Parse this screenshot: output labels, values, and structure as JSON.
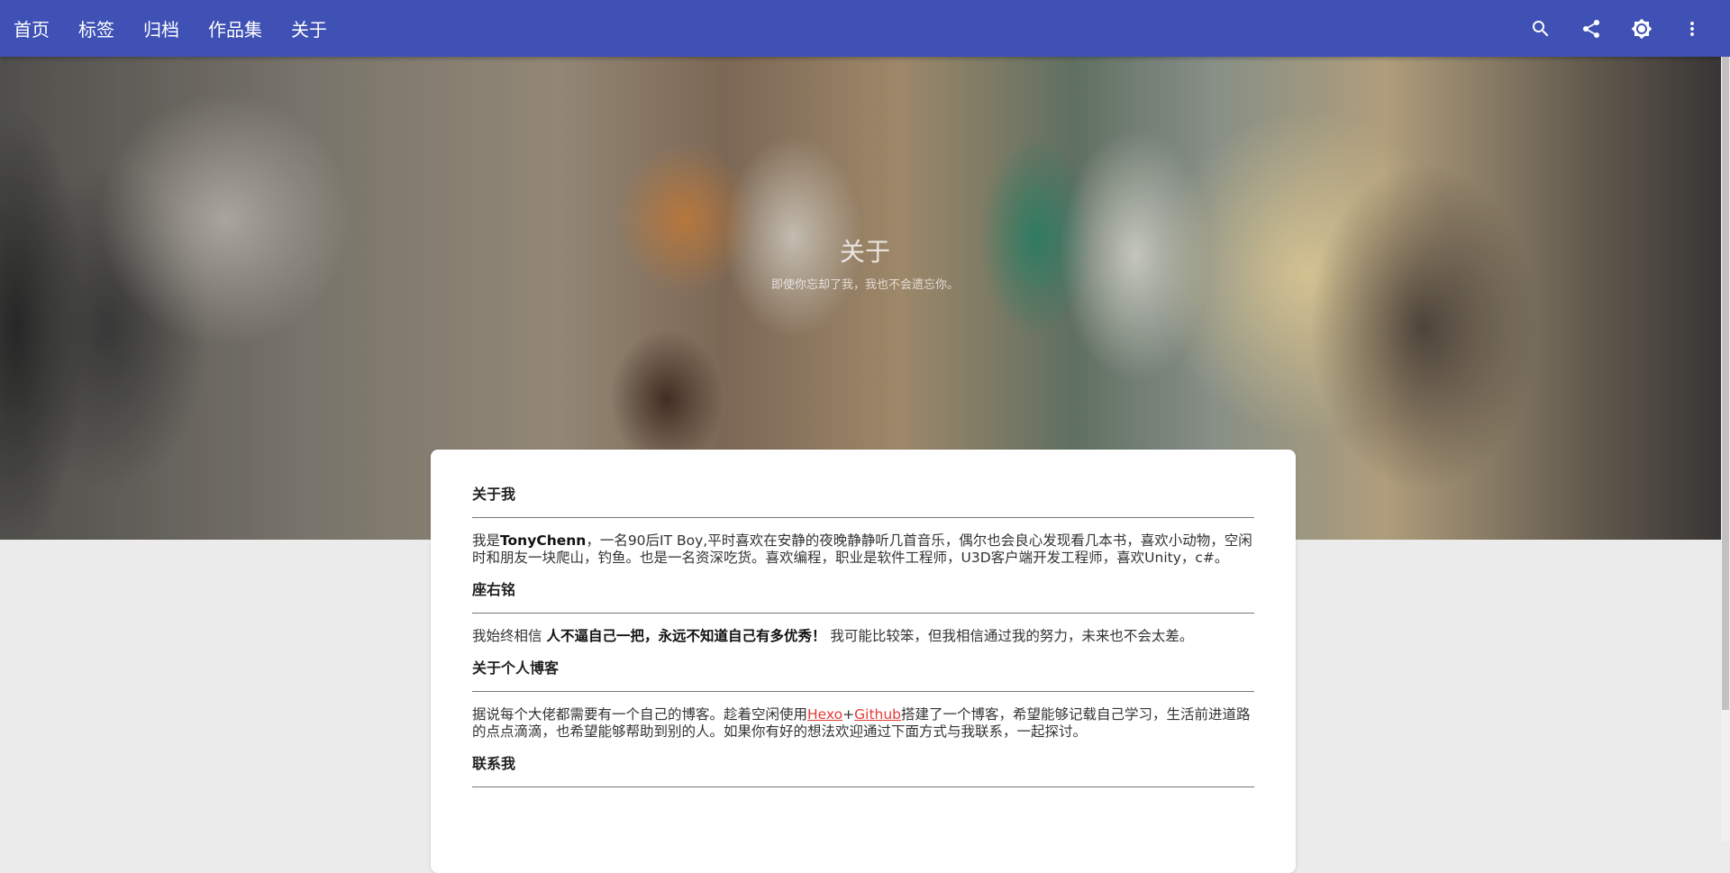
{
  "nav": {
    "items": [
      {
        "label": "首页"
      },
      {
        "label": "标签"
      },
      {
        "label": "归档"
      },
      {
        "label": "作品集"
      },
      {
        "label": "关于"
      }
    ]
  },
  "actions": {
    "icons": [
      "search-icon",
      "share-icon",
      "brightness-icon",
      "more-vert-icon"
    ]
  },
  "hero": {
    "title": "关于",
    "subtitle": "即使你忘却了我，我也不会遗忘你。"
  },
  "sections": [
    {
      "title": "关于我",
      "body_prefix": "我是",
      "body_bold": "TonyChenn",
      "body_suffix": "，一名90后IT Boy,平时喜欢在安静的夜晚静静听几首音乐，偶尔也会良心发现看几本书，喜欢小动物，空闲时和朋友一块爬山，钓鱼。也是一名资深吃货。喜欢编程，职业是软件工程师，U3D客户端开发工程师，喜欢Unity，c#。"
    },
    {
      "title": "座右铭",
      "body_prefix": "我始终相信 ",
      "body_bold": "人不逼自己一把，永远不知道自己有多优秀！",
      "body_suffix": " 我可能比较笨，但我相信通过我的努力，未来也不会太差。"
    },
    {
      "title": "关于个人博客",
      "body_prefix": "据说每个大佬都需要有一个自己的博客。趁着空闲使用",
      "link1": "Hexo",
      "plus": "+",
      "link2": "Github",
      "body_suffix": "搭建了一个博客，希望能够记载自己学习，生活前进道路的点点滴滴，也希望能够帮助到别的人。如果你有好的想法欢迎通过下面方式与我联系，一起探讨。"
    },
    {
      "title": "联系我"
    }
  ],
  "colors": {
    "appbar": "#3f51b5",
    "link": "#e53935",
    "page_bg": "#ebebeb"
  }
}
